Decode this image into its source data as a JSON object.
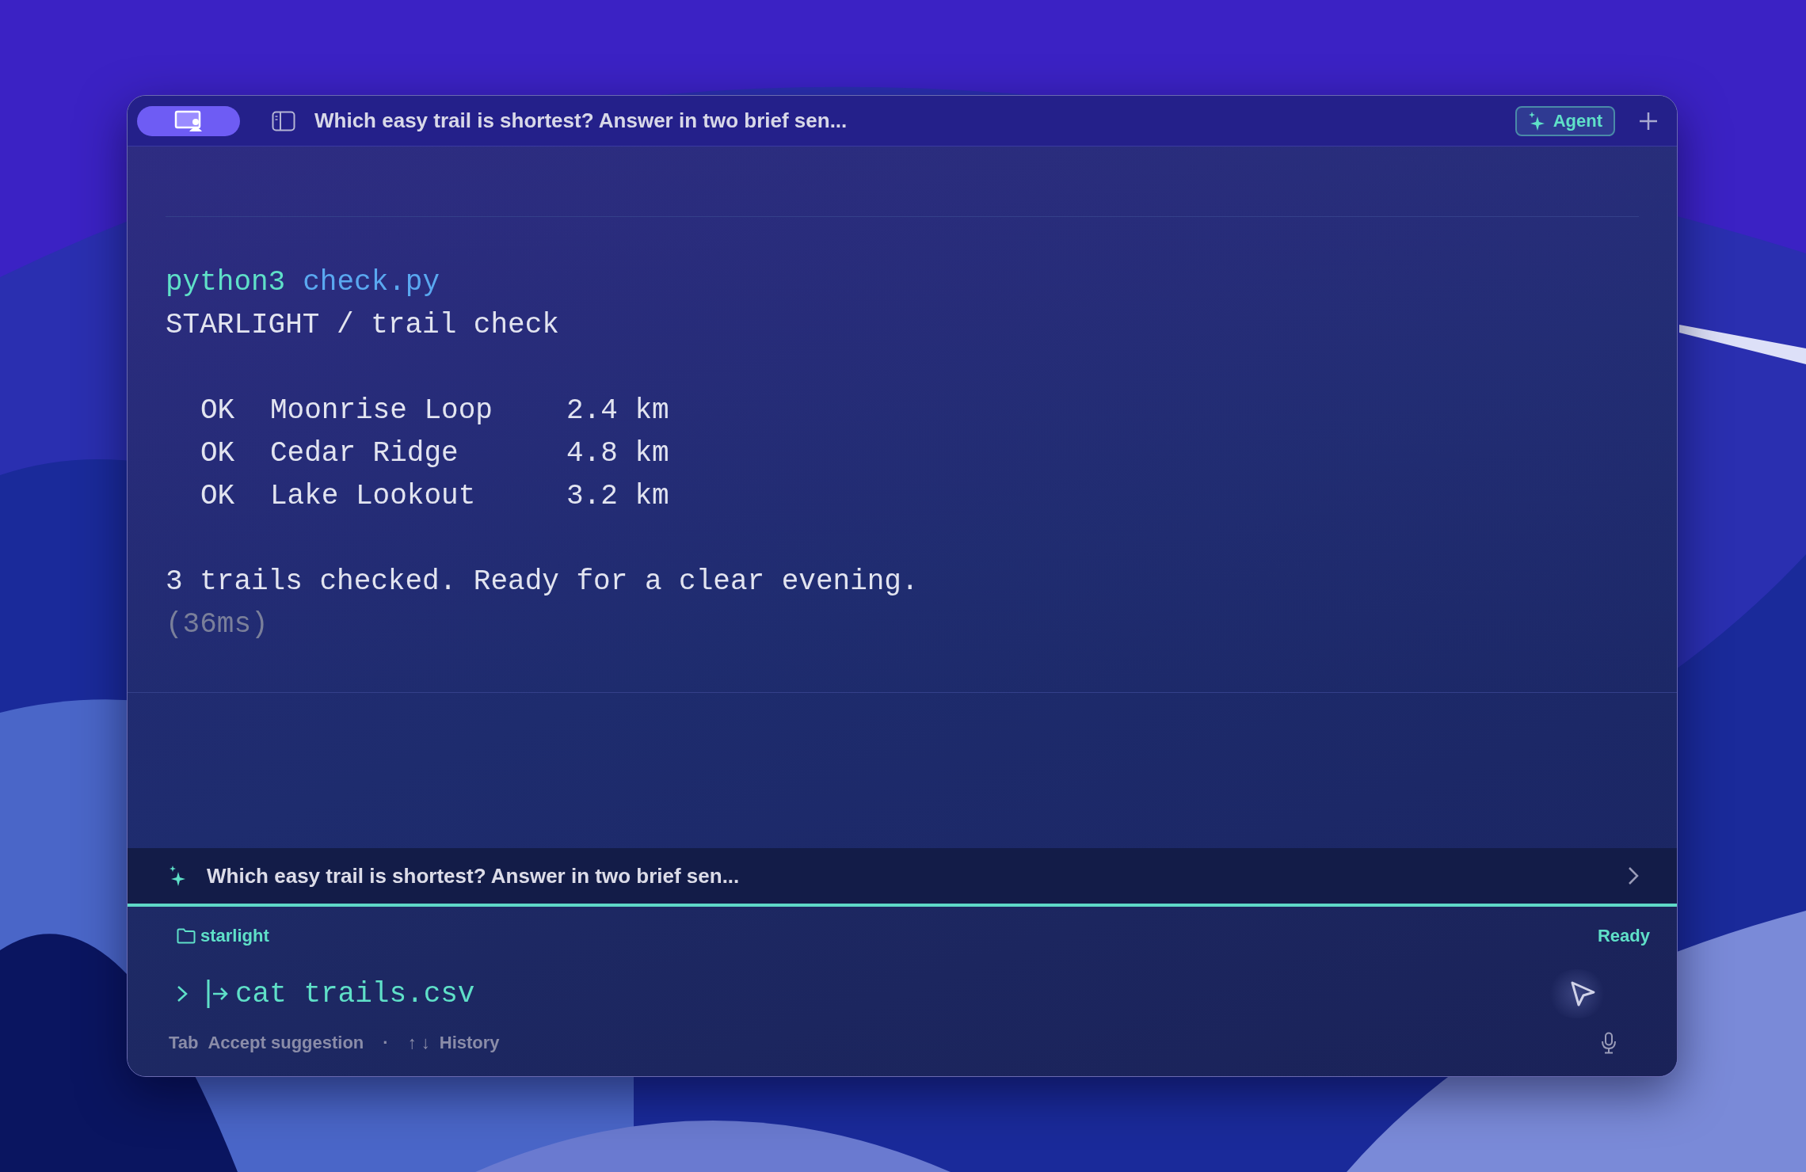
{
  "window": {
    "title": "Which easy trail is shortest? Answer in two brief sen..."
  },
  "titlebar": {
    "agent_button": "Agent"
  },
  "output": {
    "command": "python3",
    "argument": "check.py",
    "lines": [
      {
        "kind": "text",
        "text": "STARLIGHT / trail check"
      },
      {
        "kind": "blank"
      },
      {
        "kind": "row",
        "status": "OK",
        "name": "Moonrise Loop",
        "distance": "2.4 km"
      },
      {
        "kind": "row",
        "status": "OK",
        "name": "Cedar Ridge",
        "distance": "4.8 km"
      },
      {
        "kind": "row",
        "status": "OK",
        "name": "Lake Lookout",
        "distance": "3.2 km"
      },
      {
        "kind": "blank"
      },
      {
        "kind": "text",
        "text": "3 trails checked. Ready for a clear evening."
      },
      {
        "kind": "muted",
        "text": "(36ms)"
      }
    ]
  },
  "suggestion": {
    "text": "Which easy trail is shortest? Answer in two brief sen..."
  },
  "prompt": {
    "directory": "starlight",
    "status": "Ready",
    "input": "cat trails.csv"
  },
  "hints": [
    {
      "key": "Tab",
      "label": "Accept suggestion"
    },
    {
      "key": "↑ ↓",
      "label": "History"
    }
  ],
  "hint_separator": "·"
}
